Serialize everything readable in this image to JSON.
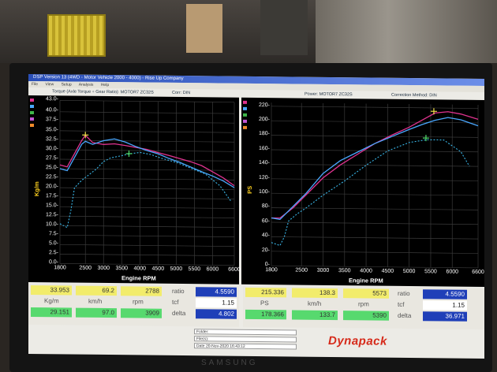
{
  "window": {
    "title": "DSP Version 13 (4WD - Motor Vehicle 2000 - 4000) - Rise Up Company",
    "menu": [
      "File",
      "View",
      "Setup",
      "Analysis",
      "Help"
    ]
  },
  "torque_chart": {
    "header_left": "Torque (Axle Torque ÷ Gear Ratio): MOTOR7 ZC32S",
    "header_right": "Corr: DIN",
    "ylabel": "Kg/m",
    "xlabel": "Engine RPM",
    "yticks": [
      "43.0-",
      "40.0-",
      "37.5-",
      "35.0-",
      "32.5-",
      "30.0-",
      "27.5-",
      "25.0-",
      "22.5-",
      "20.0-",
      "17.5-",
      "15.0-",
      "12.5-",
      "10.0-",
      "7.5-",
      "5.0-",
      "2.5-",
      "0.0-"
    ],
    "xticks": [
      "1800",
      "2500",
      "3000",
      "3500",
      "4000",
      "4500",
      "5000",
      "5500",
      "6000",
      "6600"
    ]
  },
  "power_chart": {
    "header_left": "Power: MOTOR7 ZC32S",
    "header_right": "Correction Method: DIN",
    "ylabel": "PS",
    "xlabel": "Engine RPM",
    "yticks": [
      "220-",
      "200-",
      "180-",
      "160-",
      "140-",
      "120-",
      "100-",
      "80-",
      "60-",
      "40-",
      "20-",
      "0-"
    ],
    "xticks": [
      "1800",
      "2500",
      "3000",
      "3500",
      "4000",
      "4500",
      "5000",
      "5500",
      "6000",
      "6600"
    ]
  },
  "colors": {
    "pink_run": "#e0338f",
    "blue_run": "#4aa8ff",
    "dashed_run": "#39b6e8",
    "marker_yellow": "#f3e24a",
    "marker_green": "#4fdc6b"
  },
  "chart_data": [
    {
      "type": "line",
      "title": "Torque (Axle Torque ÷ Gear Ratio): MOTOR7 ZC32S",
      "xlabel": "Engine RPM",
      "ylabel": "Kg/m",
      "xlim": [
        1800,
        6600
      ],
      "ylim": [
        0,
        43
      ],
      "series": [
        {
          "style": "solid-pink",
          "x": [
            1800,
            2000,
            2200,
            2400,
            2500,
            2700,
            3000,
            3300,
            3600,
            3900,
            4200,
            4500,
            4800,
            5100,
            5400,
            5700,
            6000,
            6300,
            6600
          ],
          "values": [
            26,
            25.5,
            29,
            32.5,
            33.9,
            32,
            31.5,
            31.7,
            31.3,
            30.8,
            30.3,
            29.5,
            28.8,
            28,
            27.2,
            26.2,
            24.6,
            23,
            21
          ]
        },
        {
          "style": "solid-blue",
          "x": [
            1800,
            2000,
            2200,
            2400,
            2500,
            2700,
            3000,
            3300,
            3600,
            3900,
            4200,
            4500,
            4800,
            5100,
            5400,
            5700,
            6000,
            6300,
            6600
          ],
          "values": [
            25,
            24.5,
            28,
            31.5,
            32.3,
            31.5,
            32.5,
            33,
            32.2,
            31,
            30,
            29.2,
            28,
            27,
            25.8,
            24.6,
            23.5,
            22.2,
            20.5
          ]
        },
        {
          "style": "dashed-blue",
          "x": [
            1800,
            1900,
            2000,
            2100,
            2200,
            2400,
            2600,
            2800,
            3000,
            3200,
            3500,
            3700,
            4000,
            4300,
            4600,
            5000,
            5400,
            5800,
            6200,
            6500
          ],
          "values": [
            10.5,
            10,
            9.5,
            14,
            20,
            22,
            23.5,
            25,
            27,
            28,
            28.6,
            29.1,
            29.5,
            29,
            28,
            27,
            25.5,
            24,
            21,
            17
          ]
        }
      ],
      "markers": [
        {
          "label": "yellow",
          "x": 2500,
          "y": 33.953
        },
        {
          "label": "green",
          "x": 3700,
          "y": 29.151
        }
      ]
    },
    {
      "type": "line",
      "title": "Power: MOTOR7 ZC32S",
      "xlabel": "Engine RPM",
      "ylabel": "PS",
      "xlim": [
        1800,
        6600
      ],
      "ylim": [
        0,
        225
      ],
      "series": [
        {
          "style": "solid-pink",
          "x": [
            1800,
            2000,
            2300,
            2600,
            3000,
            3400,
            3800,
            4200,
            4600,
            5000,
            5300,
            5600,
            5900,
            6200,
            6600
          ],
          "values": [
            66,
            66,
            80,
            98,
            122,
            140,
            155,
            170,
            182,
            193,
            203,
            213,
            215,
            212,
            205
          ]
        },
        {
          "style": "solid-blue",
          "x": [
            1800,
            2000,
            2300,
            2600,
            3000,
            3400,
            3800,
            4200,
            4600,
            5000,
            5300,
            5600,
            5900,
            6200,
            6600
          ],
          "values": [
            66,
            64,
            82,
            100,
            128,
            146,
            158,
            170,
            180,
            190,
            197,
            203,
            207,
            204,
            196
          ]
        },
        {
          "style": "dashed-blue",
          "x": [
            1800,
            1900,
            2000,
            2100,
            2200,
            2400,
            2600,
            3000,
            3500,
            4000,
            4500,
            5000,
            5400,
            5800,
            6200,
            6400
          ],
          "values": [
            32,
            30,
            28,
            40,
            62,
            72,
            80,
            98,
            118,
            140,
            160,
            172,
            176,
            176,
            160,
            140
          ]
        }
      ],
      "markers": [
        {
          "label": "yellow",
          "x": 5573,
          "y": 215.336
        },
        {
          "label": "green",
          "x": 5390,
          "y": 178.366
        }
      ]
    }
  ],
  "readouts": {
    "left": {
      "yellow": [
        "33.953",
        "69.2",
        "2788"
      ],
      "units": [
        "Kg/m",
        "km/h",
        "rpm"
      ],
      "green": [
        "29.151",
        "97.0",
        "3909"
      ],
      "ratio_label": "ratio",
      "ratio": "4.5590",
      "tcf_label": "tcf",
      "tcf": "1.15",
      "delta_label": "delta",
      "delta": "4.802"
    },
    "right": {
      "yellow": [
        "215.336",
        "138.3",
        "5573"
      ],
      "units": [
        "PS",
        "km/h",
        "rpm"
      ],
      "green": [
        "178.366",
        "133.7",
        "5390"
      ],
      "ratio_label": "ratio",
      "ratio": "4.5590",
      "tcf_label": "tcf",
      "tcf": "1.15",
      "delta_label": "delta",
      "delta": "36.971"
    }
  },
  "footer": {
    "folder": "Folder:",
    "file": "File(s):",
    "date": "Date 20-Nov-2020 16:43:12",
    "brand": "Dynapack"
  },
  "monitor_brand": "SAMSUNG"
}
